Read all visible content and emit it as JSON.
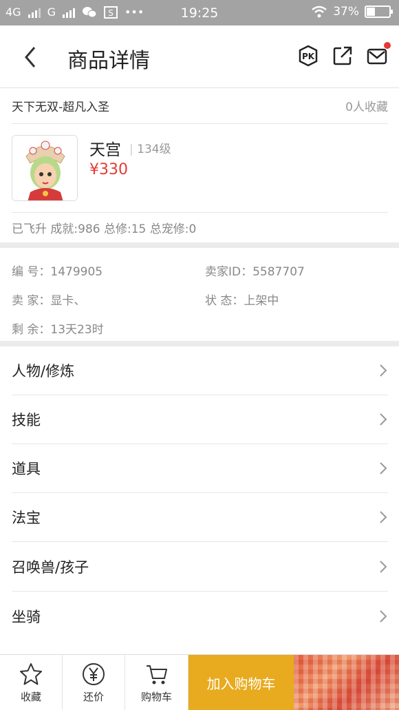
{
  "status_bar": {
    "network_1": "4G",
    "network_2": "G",
    "time": "19:25",
    "battery": "37%",
    "battery_level": 0.37
  },
  "nav": {
    "title": "商品详情"
  },
  "item": {
    "server": "天下无双-超凡入圣",
    "favorites": "0人收藏",
    "school": "天宫",
    "level": "134级",
    "price": "¥330",
    "stats": "已飞升 成就:986 总修:15 总宠修:0"
  },
  "details": {
    "id_label": "编  号：",
    "id_value": "1479905",
    "seller_id_label": "卖家ID：",
    "seller_id_value": "5587707",
    "seller_label": "卖  家：",
    "seller_value": "显卡、",
    "status_label": "状  态：",
    "status_value": "上架中",
    "remain_label": "剩  余：",
    "remain_value": "13天23时"
  },
  "menu": [
    {
      "label": "人物/修炼"
    },
    {
      "label": "技能"
    },
    {
      "label": "道具"
    },
    {
      "label": "法宝"
    },
    {
      "label": "召唤兽/孩子"
    },
    {
      "label": "坐骑"
    }
  ],
  "bottom": {
    "favorite": "收藏",
    "bargain": "还价",
    "cart": "购物车",
    "add_to_cart": "加入购物车"
  },
  "colors": {
    "price": "#e53935",
    "add_to_cart_bg": "#e8aa1e",
    "status_bar_bg": "#a3a3a3"
  }
}
